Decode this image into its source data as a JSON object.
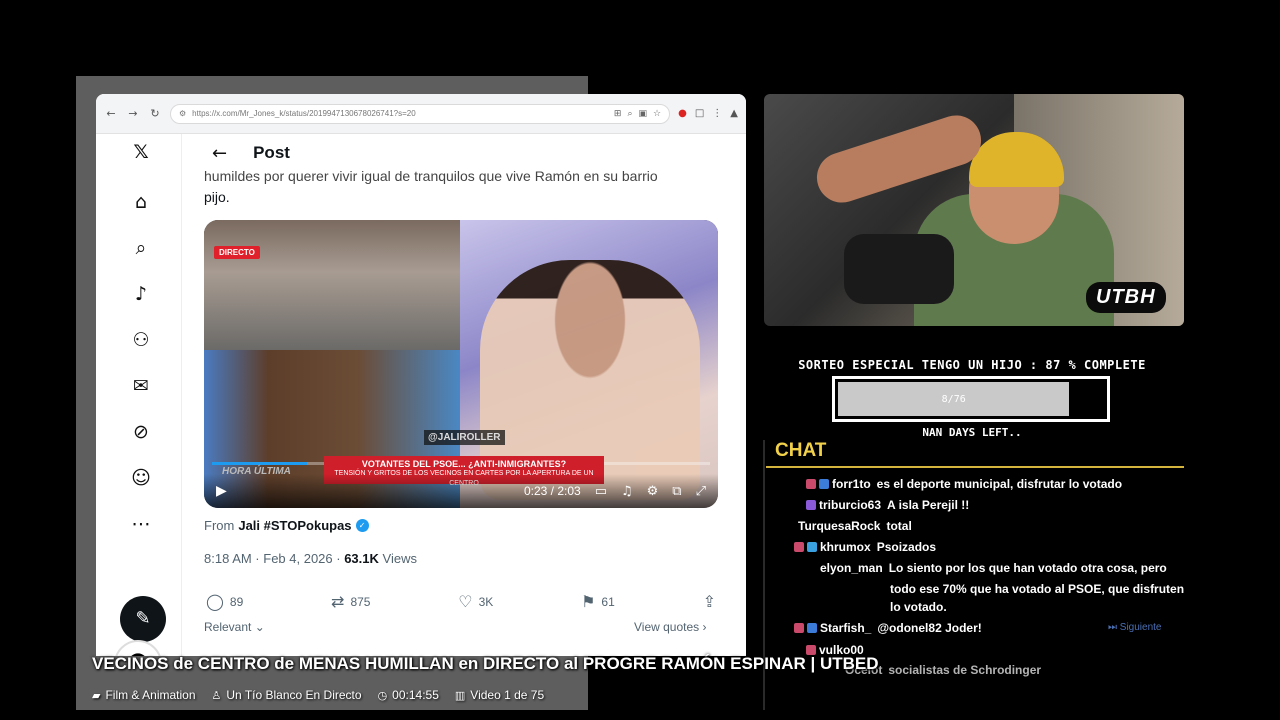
{
  "browser": {
    "url": "https://x.com/Mr_Jones_k/status/2019947130678026741?s=20"
  },
  "post": {
    "header_title": "Post",
    "text_line1": "humildes por querer vivir igual de tranquilos que vive Ramón en su barrio",
    "text_line2": "pijo.",
    "video": {
      "live_label": "DIRECTO",
      "handle_overlay": "@JALIROLLER",
      "lower_third_title": "VOTANTES DEL PSOE... ¿ANTI-INMIGRANTES?",
      "lower_third_sub": "TENSIÓN Y GRITOS DE LOS VECINOS EN CARTES POR LA APERTURA DE UN CENTRO",
      "ticker": "HORA ÚLTIMA",
      "time": "0:23 / 2:03",
      "progress": 0.19
    },
    "from_prefix": "From",
    "from_author": "Jali #STOPokupas",
    "timestamp": "8:18 AM · Feb 4, 2026 · ",
    "views_count": "63.1K",
    "views_label": " Views",
    "replies": "89",
    "reposts": "875",
    "likes": "3K",
    "bookmarks": "61",
    "relevant": "Relevant ⌄",
    "view_quotes": "View quotes ›"
  },
  "cam": {
    "badge": "UTBH"
  },
  "goal": {
    "title": "SORTEO ESPECIAL TENGO UN HIJO :  87 % COMPLETE",
    "inner": "8/76",
    "days": "NAN DAYS LEFT..",
    "progress": 0.87
  },
  "chat": {
    "title": "CHAT",
    "next": "⏭ Siguiente",
    "messages": [
      {
        "user": "forr1to",
        "color": "#ff6b8a",
        "text": "es el deporte municipal, disfrutar lo votado"
      },
      {
        "user": "triburcio63",
        "color": "#7b8cff",
        "text": "A isla Perejil !!"
      },
      {
        "user": "TurquesaRock",
        "color": "#ff8c2a",
        "text": "total"
      },
      {
        "user": "khrumox",
        "color": "#48b2ff",
        "text": "Psoizados"
      },
      {
        "user": "elyon_man",
        "color": "#45d07a",
        "text": "Lo siento por los que han votado otra cosa, pero"
      },
      {
        "user": "",
        "color": "#ffffff",
        "text": "todo ese 70% que ha votado al PSOE, que disfruten"
      },
      {
        "user": "",
        "color": "#ffffff",
        "text": "lo votado."
      },
      {
        "user": "Starfish_",
        "color": "#e33a3a",
        "text": "@odonel82 Joder!"
      },
      {
        "user": "vulko00",
        "color": "#d8d84a",
        "text": ""
      },
      {
        "user": "Ocelot",
        "color": "#e33a3a",
        "text": "socialistas de Schrodinger"
      }
    ]
  },
  "overlay": {
    "title": "VECINOS de CENTRO de MENAS HUMILLAN en DIRECTO al PROGRE RAMÓN ESPINAR | UTBED",
    "category": "Film & Animation",
    "channel": "Un Tío Blanco En Directo",
    "duration": "00:14:55",
    "playlist": "Video 1 de 75"
  }
}
